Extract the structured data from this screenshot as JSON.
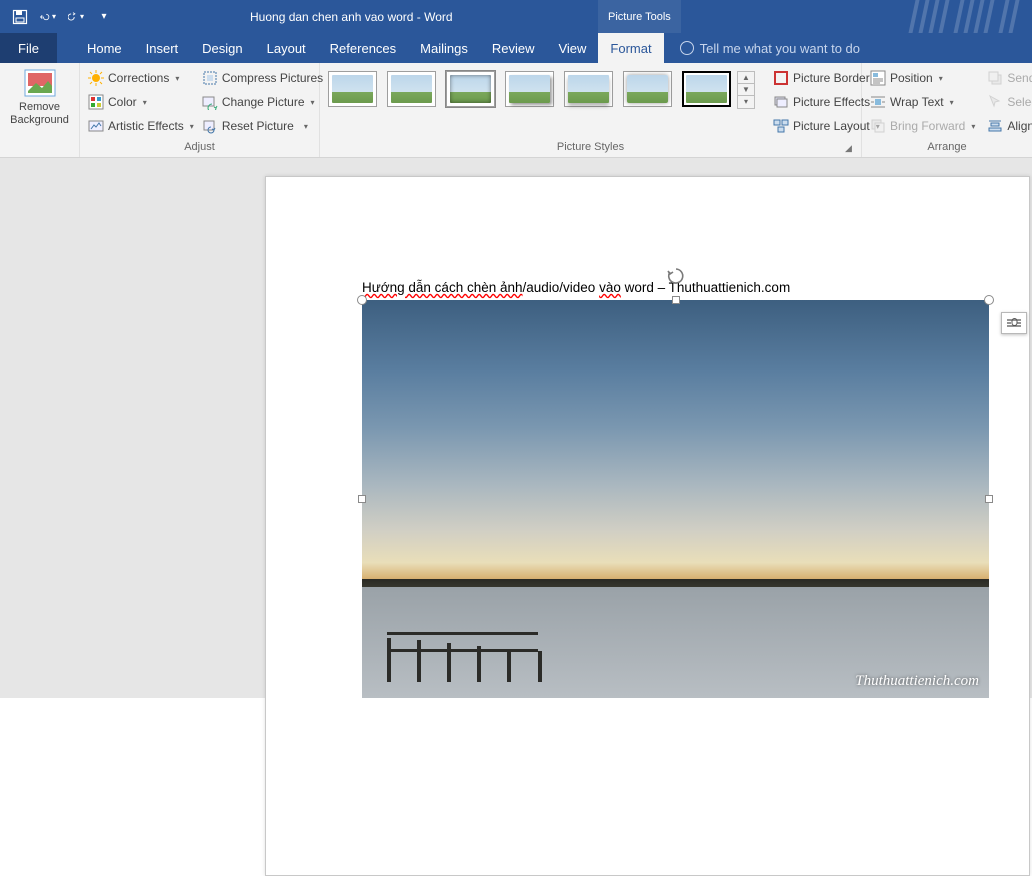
{
  "title": "Huong dan chen anh vao word  -  Word",
  "context_tab": "Picture Tools",
  "tabs": {
    "file": "File",
    "home": "Home",
    "insert": "Insert",
    "design": "Design",
    "layout": "Layout",
    "references": "References",
    "mailings": "Mailings",
    "review": "Review",
    "view": "View",
    "format": "Format"
  },
  "tellme": "Tell me what you want to do",
  "ribbon": {
    "remove_bg_l1": "Remove",
    "remove_bg_l2": "Background",
    "adjust_group": "Adjust",
    "corrections": "Corrections",
    "color": "Color",
    "artistic": "Artistic Effects",
    "compress": "Compress Pictures",
    "change": "Change Picture",
    "reset": "Reset Picture",
    "styles_group": "Picture Styles",
    "pborder": "Picture Border",
    "peffects": "Picture Effects",
    "playout": "Picture Layout",
    "position": "Position",
    "wrap": "Wrap Text",
    "bringfwd": "Bring Forward",
    "send": "Send",
    "select": "Select",
    "align": "Align",
    "arrange_group": "Arrange"
  },
  "doc": {
    "text_a": "Hướng dẫn cách chèn ảnh",
    "text_b": "/audio/video ",
    "text_c": "vào",
    "text_d": " word – Thuthuattienich.com",
    "watermark": "Thuthuattienich.com"
  }
}
